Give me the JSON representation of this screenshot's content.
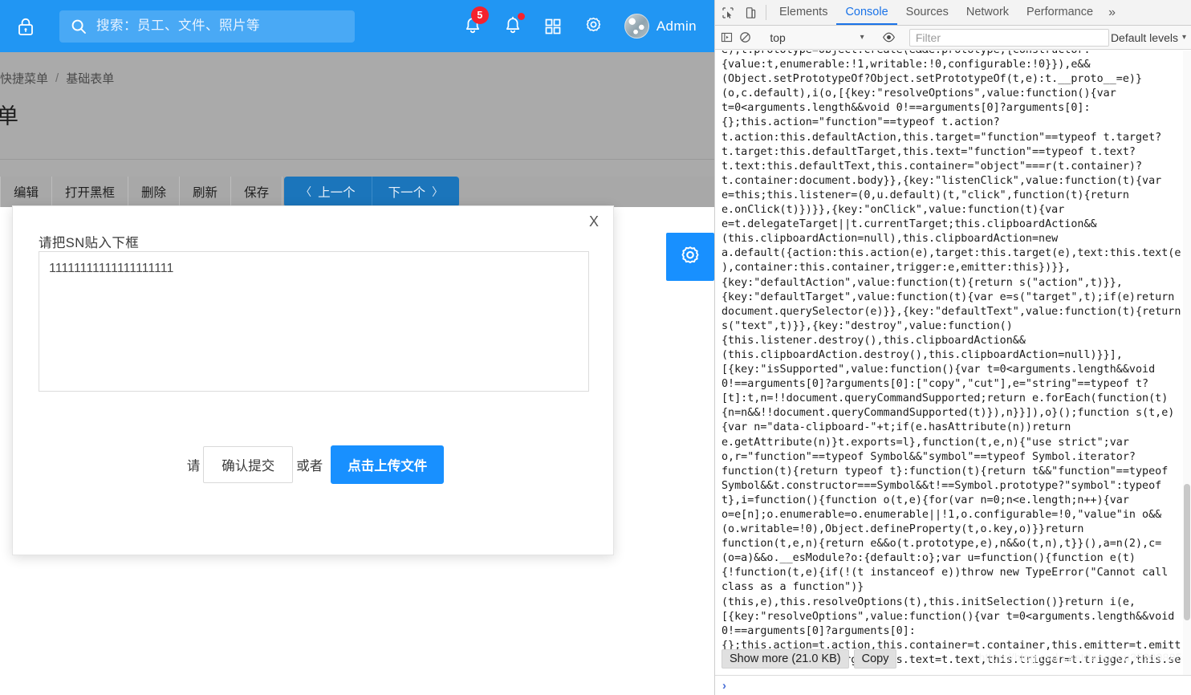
{
  "app": {
    "header": {
      "lock_icon": "lock-icon",
      "search": {
        "icon": "search-icon",
        "placeholder": "搜索：员工、文件、照片等",
        "value": ""
      },
      "notifications_badge": "5",
      "icons": [
        "bell-icon",
        "bell-alert-icon",
        "apps-grid-icon",
        "gear-icon"
      ],
      "user": {
        "name": "Admin",
        "avatar": "avatar"
      }
    },
    "breadcrumb": {
      "items": [
        "快捷菜单",
        "基础表单"
      ],
      "separator": "/"
    },
    "page_title": "单",
    "toolbar": {
      "buttons": [
        "编辑",
        "打开黑框",
        "删除",
        "刷新",
        "保存"
      ],
      "nav": {
        "prev": "上一个",
        "next": "下一个",
        "prev_chevron": "〈",
        "next_chevron": "〉"
      }
    },
    "fab": {
      "icon": "gear-icon"
    },
    "modal": {
      "close_label": "X",
      "label": "请把SN贴入下框",
      "textarea_value": "11111111111111111111",
      "textarea_placeholder": "",
      "footer_prefix": "请",
      "confirm_label": "确认提交",
      "footer_middle": "或者",
      "upload_label": "点击上传文件"
    },
    "colors": {
      "header_blue": "#2196f3",
      "primary_blue": "#1890ff",
      "nav_blue": "#1b75bb",
      "badge_red": "#f5222d",
      "grey_body": "#aaaaaa",
      "toolbar_grey": "#a8a8a8"
    }
  },
  "devtools": {
    "tabs": [
      {
        "label": "Elements",
        "active": false
      },
      {
        "label": "Console",
        "active": true
      },
      {
        "label": "Sources",
        "active": false
      },
      {
        "label": "Network",
        "active": false
      },
      {
        "label": "Performance",
        "active": false
      }
    ],
    "more_label": "»",
    "tool_icons": [
      "inspect-element-icon",
      "device-toolbar-icon"
    ],
    "filterbar": {
      "execute_icon": "execute-sidebar-icon",
      "clear_icon": "clear-console-icon",
      "context": "top",
      "context_caret": "▾",
      "eye_icon": "live-expression-icon",
      "filter_placeholder": "Filter",
      "filter_value": "",
      "levels_label": "Default levels",
      "levels_caret": "▾"
    },
    "console_output": "e),t.prototype=Object.create(e&&e.prototype,{constructor:\n{value:t,enumerable:!1,writable:!0,configurable:!0}}),e&&\n(Object.setPrototypeOf?Object.setPrototypeOf(t,e):t.__proto__=e)}\n(o,c.default),i(o,[{key:\"resolveOptions\",value:function(){var\nt=0<arguments.length&&void 0!==arguments[0]?arguments[0]:\n{};this.action=\"function\"==typeof t.action?\nt.action:this.defaultAction,this.target=\"function\"==typeof t.target?\nt.target:this.defaultTarget,this.text=\"function\"==typeof t.text?\nt.text:this.defaultText,this.container=\"object\"===r(t.container)?\nt.container:document.body}},{key:\"listenClick\",value:function(t){var\ne=this;this.listener=(0,u.default)(t,\"click\",function(t){return\ne.onClick(t)})}},{key:\"onClick\",value:function(t){var\ne=t.delegateTarget||t.currentTarget;this.clipboardAction&&\n(this.clipboardAction=null),this.clipboardAction=new\na.default({action:this.action(e),target:this.target(e),text:this.text(e\n),container:this.container,trigger:e,emitter:this})}},\n{key:\"defaultAction\",value:function(t){return s(\"action\",t)}},\n{key:\"defaultTarget\",value:function(t){var e=s(\"target\",t);if(e)return\ndocument.querySelector(e)}},{key:\"defaultText\",value:function(t){return\ns(\"text\",t)}},{key:\"destroy\",value:function()\n{this.listener.destroy(),this.clipboardAction&&\n(this.clipboardAction.destroy(),this.clipboardAction=null)}}],\n[{key:\"isSupported\",value:function(){var t=0<arguments.length&&void\n0!==arguments[0]?arguments[0]:[\"copy\",\"cut\"],e=\"string\"==typeof t?\n[t]:t,n=!!document.queryCommandSupported;return e.forEach(function(t)\n{n=n&&!!document.queryCommandSupported(t)}),n}}]),o}();function s(t,e)\n{var n=\"data-clipboard-\"+t;if(e.hasAttribute(n))return\ne.getAttribute(n)}t.exports=l},function(t,e,n){\"use strict\";var\no,r=\"function\"==typeof Symbol&&\"symbol\"==typeof Symbol.iterator?\nfunction(t){return typeof t}:function(t){return t&&\"function\"==typeof\nSymbol&&t.constructor===Symbol&&t!==Symbol.prototype?\"symbol\":typeof\nt},i=function(){function o(t,e){for(var n=0;n<e.length;n++){var\no=e[n];o.enumerable=o.enumerable||!1,o.configurable=!0,\"value\"in o&&\n(o.writable=!0),Object.defineProperty(t,o.key,o)}}return\nfunction(t,e,n){return e&&o(t.prototype,e),n&&o(t,n),t}}(),a=n(2),c=\n(o=a)&&o.__esModule?o:{default:o};var u=function(){function e(t)\n{!function(t,e){if(!(t instanceof e))throw new TypeError(\"Cannot call\nclass as a function\")}\n(this,e),this.resolveOptions(t),this.initSelection()}return i(e,\n[{key:\"resolveOptions\",value:function(){var t=0<arguments.length&&void\n0!==arguments[0]?arguments[0]:\n{};this.action=t.action,this.container=t.container,this.emitter=t.emitt\ner,this.target=t.target,this.text=t.text,this.trigger=t.trigger,this.se",
    "show_more_label": "Show more (21.0 KB)",
    "copy_label": "Copy",
    "watermark": "https://blog.csdn.net/tangrlou359098855",
    "prompt": "›"
  }
}
